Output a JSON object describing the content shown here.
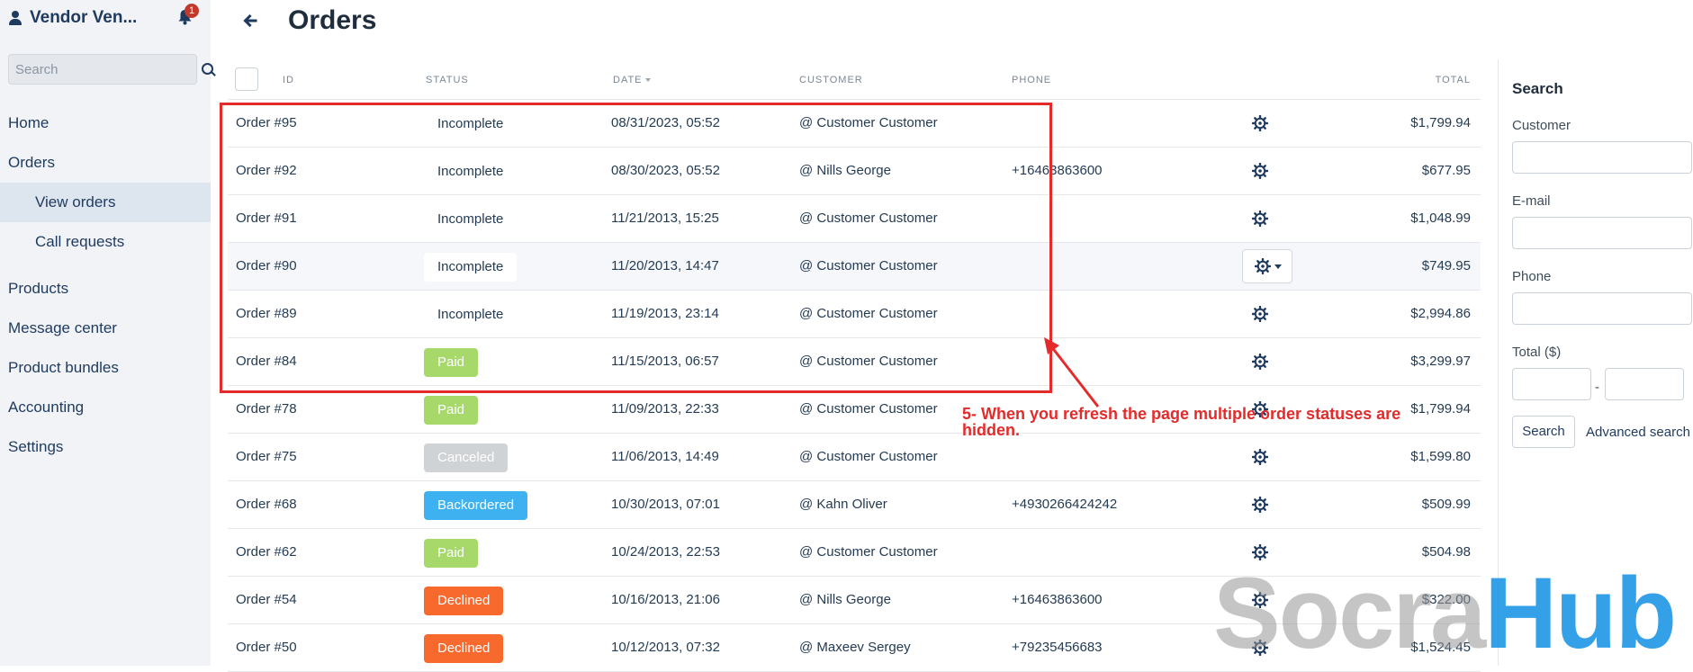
{
  "app": {
    "vendor_name": "Vendor Ven...",
    "notifications_count": "1",
    "search_placeholder": "Search"
  },
  "sidebar": {
    "items": [
      {
        "label": "Home"
      },
      {
        "label": "Orders"
      },
      {
        "label": "View orders",
        "active": true
      },
      {
        "label": "Call requests"
      },
      {
        "label": "Products"
      },
      {
        "label": "Message center"
      },
      {
        "label": "Product bundles"
      },
      {
        "label": "Accounting"
      },
      {
        "label": "Settings"
      }
    ]
  },
  "page": {
    "title": "Orders"
  },
  "table": {
    "headers": {
      "id": "ID",
      "status": "STATUS",
      "date": "DATE",
      "customer": "CUSTOMER",
      "phone": "PHONE",
      "total": "TOTAL"
    },
    "rows": [
      {
        "id": "Order #95",
        "status": "Incomplete",
        "status_type": "plain",
        "date": "08/31/2023, 05:52",
        "customer": "@ Customer Customer",
        "phone": "",
        "total": "$1,799.94"
      },
      {
        "id": "Order #92",
        "status": "Incomplete",
        "status_type": "plain",
        "date": "08/30/2023, 05:52",
        "customer": "@ Nills George",
        "phone": "+16463863600",
        "total": "$677.95"
      },
      {
        "id": "Order #91",
        "status": "Incomplete",
        "status_type": "plain",
        "date": "11/21/2013, 15:25",
        "customer": "@ Customer Customer",
        "phone": "",
        "total": "$1,048.99"
      },
      {
        "id": "Order #90",
        "status": "Incomplete",
        "status_type": "plain",
        "date": "11/20/2013, 14:47",
        "customer": "@ Customer Customer",
        "phone": "",
        "total": "$749.95",
        "hover": true
      },
      {
        "id": "Order #89",
        "status": "Incomplete",
        "status_type": "plain",
        "date": "11/19/2013, 23:14",
        "customer": "@ Customer Customer",
        "phone": "",
        "total": "$2,994.86"
      },
      {
        "id": "Order #84",
        "status": "Paid",
        "status_type": "paid",
        "date": "11/15/2013, 06:57",
        "customer": "@ Customer Customer",
        "phone": "",
        "total": "$3,299.97"
      },
      {
        "id": "Order #78",
        "status": "Paid",
        "status_type": "paid",
        "date": "11/09/2013, 22:33",
        "customer": "@ Customer Customer",
        "phone": "",
        "total": "$1,799.94"
      },
      {
        "id": "Order #75",
        "status": "Canceled",
        "status_type": "canceled",
        "date": "11/06/2013, 14:49",
        "customer": "@ Customer Customer",
        "phone": "",
        "total": "$1,599.80"
      },
      {
        "id": "Order #68",
        "status": "Backordered",
        "status_type": "backordered",
        "date": "10/30/2013, 07:01",
        "customer": "@ Kahn Oliver",
        "phone": "+4930266424242",
        "total": "$509.99"
      },
      {
        "id": "Order #62",
        "status": "Paid",
        "status_type": "paid",
        "date": "10/24/2013, 22:53",
        "customer": "@ Customer Customer",
        "phone": "",
        "total": "$504.98"
      },
      {
        "id": "Order #54",
        "status": "Declined",
        "status_type": "declined",
        "date": "10/16/2013, 21:06",
        "customer": "@ Nills George",
        "phone": "+16463863600",
        "total": "$322.00"
      },
      {
        "id": "Order #50",
        "status": "Declined",
        "status_type": "declined",
        "date": "10/12/2013, 07:32",
        "customer": "@ Maxeev Sergey",
        "phone": "+79235456683",
        "total": "$1,524.45"
      }
    ]
  },
  "search_panel": {
    "title": "Search",
    "customer_label": "Customer",
    "email_label": "E-mail",
    "phone_label": "Phone",
    "total_label": "Total ($)",
    "range_separator": "-",
    "search_button": "Search",
    "advanced_link": "Advanced search"
  },
  "annotation": {
    "text": "5- When you refresh the page multiple order statuses are hidden.",
    "color": "#e32b2b"
  },
  "watermark": {
    "part1": "Socra",
    "part2": "Hub"
  }
}
